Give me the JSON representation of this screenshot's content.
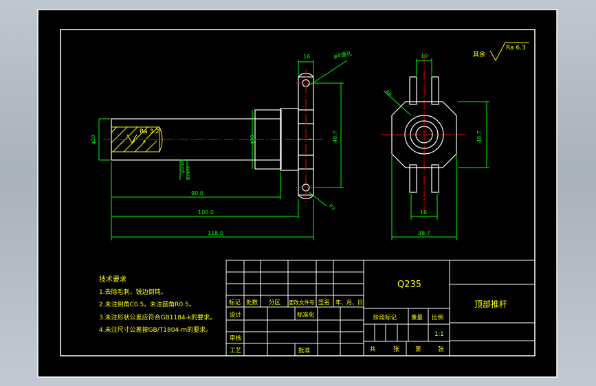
{
  "technical_requirements": {
    "heading": "技术要求",
    "items": [
      "1.去除毛刺，锐边倒钝。",
      "2.未注倒角C0.5，未注圆角R0.5。",
      "3.未注形状公差应符合GB1184-k的要求。",
      "4.未注尺寸公差按GB/T1804-m的要求。"
    ]
  },
  "surface_finish": {
    "label": "其余",
    "value": "Ra 6.3"
  },
  "title_block": {
    "material": "Q235",
    "part_name": "顶部推杆",
    "row_labels": [
      "标记",
      "处数",
      "分区",
      "更改文件号",
      "签名",
      "年、月、日"
    ],
    "design": "设计",
    "standardization": "标准化",
    "stage_mark": "阶段标记",
    "weight": "重量",
    "scale_label": "比例",
    "scale_value": "1:1",
    "review": "审核",
    "process": "工艺",
    "approve": "批准",
    "sheet_info": [
      "共",
      "张",
      "第",
      "张"
    ]
  },
  "dimensions": {
    "hole_note": "φ4通孔",
    "d20": "φ20",
    "d30": "φ30",
    "roughness_inner": "Ra 3.2",
    "thread_a": "φ10H9",
    "thread_b": "φ14H9",
    "len_1": "90.0",
    "len_2": "100.0",
    "len_3": "118.0",
    "w16_top": "16",
    "h_left": "40.7",
    "r_small": "R3",
    "r_big": "R8",
    "w10_right": "10",
    "h_right": "40.7",
    "w16_right": "16",
    "w387": "38.7"
  },
  "colors": {
    "geometry": "#ffffff",
    "dimension": "#00ff00",
    "centerline": "#ff0000",
    "hatch": "#ffff00",
    "text": "#ffff00"
  }
}
